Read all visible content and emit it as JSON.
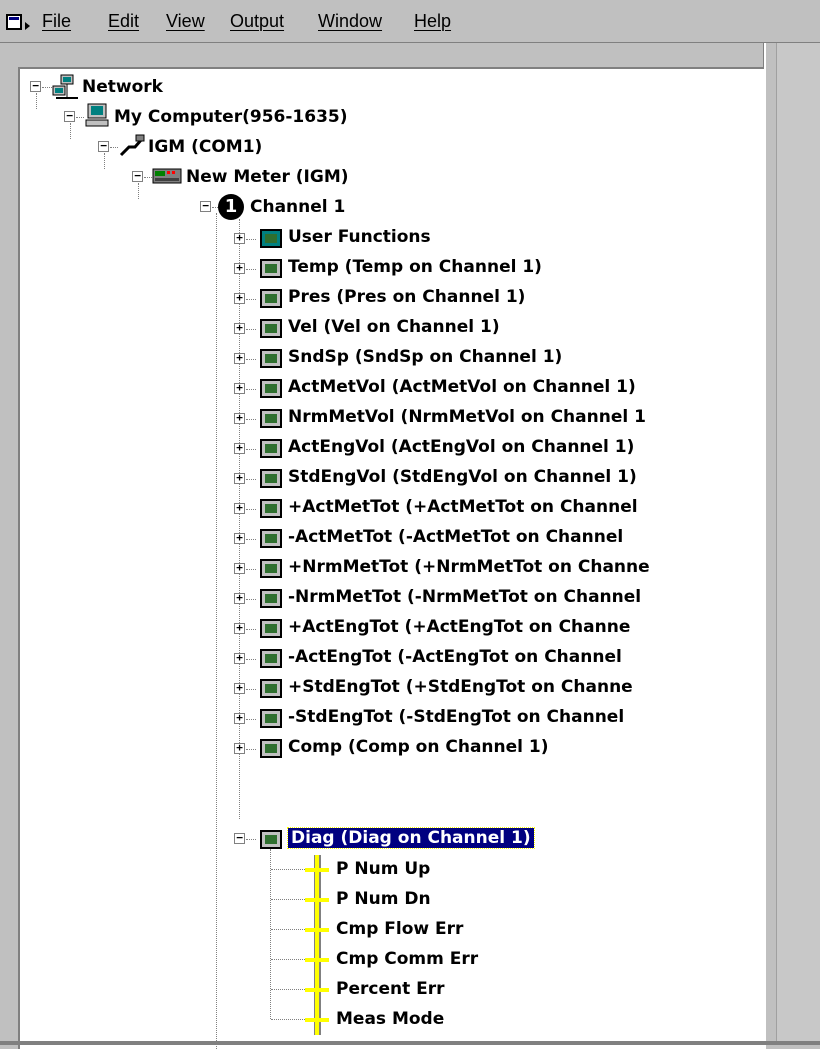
{
  "menu": {
    "file": "File",
    "edit": "Edit",
    "view": "View",
    "output": "Output",
    "window": "Window",
    "help": "Help"
  },
  "tree": {
    "network": "Network",
    "computer": "My Computer(956-1635)",
    "port": "IGM (COM1)",
    "meter": "New Meter (IGM)",
    "channel": "Channel 1",
    "channel_icon_glyph": "1",
    "functions": [
      "User Functions",
      "Temp (Temp on Channel 1)",
      "Pres (Pres on Channel 1)",
      "Vel (Vel on Channel 1)",
      "SndSp (SndSp on Channel 1)",
      "ActMetVol (ActMetVol on Channel 1)",
      "NrmMetVol (NrmMetVol on Channel 1",
      "ActEngVol (ActEngVol on Channel 1)",
      "StdEngVol (StdEngVol on Channel 1)",
      "+ActMetTot (+ActMetTot on Channel",
      "-ActMetTot (-ActMetTot on Channel",
      "+NrmMetTot (+NrmMetTot on Channe",
      "-NrmMetTot (-NrmMetTot on Channel",
      "+ActEngTot (+ActEngTot on Channe",
      "-ActEngTot (-ActEngTot on Channel",
      "+StdEngTot (+StdEngTot on Channe",
      "-StdEngTot (-StdEngTot on Channel",
      "Comp (Comp on Channel 1)"
    ],
    "selected": "Diag (Diag on Channel 1)",
    "diag_children": [
      "P Num Up",
      "P Num Dn",
      "Cmp Flow Err",
      "Cmp Comm Err",
      "Percent Err",
      "Meas Mode"
    ]
  },
  "colors": {
    "selection_bg": "#000080",
    "window_bg": "#c0c0c0",
    "diag_bar": "#ffff00"
  },
  "icons": {
    "network": "network-icon",
    "computer": "computer-icon",
    "port": "serial-port-icon",
    "meter": "meter-icon",
    "function": "function-block-icon",
    "user_functions": "calculator-icon",
    "diag_item": "signal-bar-icon"
  }
}
